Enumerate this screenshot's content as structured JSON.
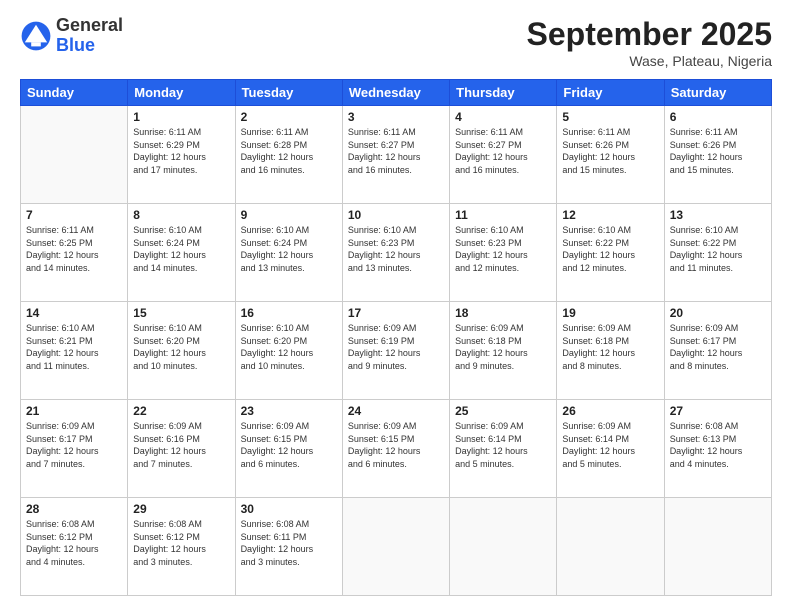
{
  "header": {
    "logo": {
      "general": "General",
      "blue": "Blue"
    },
    "title": "September 2025",
    "subtitle": "Wase, Plateau, Nigeria"
  },
  "calendar": {
    "days": [
      "Sunday",
      "Monday",
      "Tuesday",
      "Wednesday",
      "Thursday",
      "Friday",
      "Saturday"
    ],
    "weeks": [
      [
        {
          "day": "",
          "info": ""
        },
        {
          "day": "1",
          "info": "Sunrise: 6:11 AM\nSunset: 6:29 PM\nDaylight: 12 hours\nand 17 minutes."
        },
        {
          "day": "2",
          "info": "Sunrise: 6:11 AM\nSunset: 6:28 PM\nDaylight: 12 hours\nand 16 minutes."
        },
        {
          "day": "3",
          "info": "Sunrise: 6:11 AM\nSunset: 6:27 PM\nDaylight: 12 hours\nand 16 minutes."
        },
        {
          "day": "4",
          "info": "Sunrise: 6:11 AM\nSunset: 6:27 PM\nDaylight: 12 hours\nand 16 minutes."
        },
        {
          "day": "5",
          "info": "Sunrise: 6:11 AM\nSunset: 6:26 PM\nDaylight: 12 hours\nand 15 minutes."
        },
        {
          "day": "6",
          "info": "Sunrise: 6:11 AM\nSunset: 6:26 PM\nDaylight: 12 hours\nand 15 minutes."
        }
      ],
      [
        {
          "day": "7",
          "info": "Sunrise: 6:11 AM\nSunset: 6:25 PM\nDaylight: 12 hours\nand 14 minutes."
        },
        {
          "day": "8",
          "info": "Sunrise: 6:10 AM\nSunset: 6:24 PM\nDaylight: 12 hours\nand 14 minutes."
        },
        {
          "day": "9",
          "info": "Sunrise: 6:10 AM\nSunset: 6:24 PM\nDaylight: 12 hours\nand 13 minutes."
        },
        {
          "day": "10",
          "info": "Sunrise: 6:10 AM\nSunset: 6:23 PM\nDaylight: 12 hours\nand 13 minutes."
        },
        {
          "day": "11",
          "info": "Sunrise: 6:10 AM\nSunset: 6:23 PM\nDaylight: 12 hours\nand 12 minutes."
        },
        {
          "day": "12",
          "info": "Sunrise: 6:10 AM\nSunset: 6:22 PM\nDaylight: 12 hours\nand 12 minutes."
        },
        {
          "day": "13",
          "info": "Sunrise: 6:10 AM\nSunset: 6:22 PM\nDaylight: 12 hours\nand 11 minutes."
        }
      ],
      [
        {
          "day": "14",
          "info": "Sunrise: 6:10 AM\nSunset: 6:21 PM\nDaylight: 12 hours\nand 11 minutes."
        },
        {
          "day": "15",
          "info": "Sunrise: 6:10 AM\nSunset: 6:20 PM\nDaylight: 12 hours\nand 10 minutes."
        },
        {
          "day": "16",
          "info": "Sunrise: 6:10 AM\nSunset: 6:20 PM\nDaylight: 12 hours\nand 10 minutes."
        },
        {
          "day": "17",
          "info": "Sunrise: 6:09 AM\nSunset: 6:19 PM\nDaylight: 12 hours\nand 9 minutes."
        },
        {
          "day": "18",
          "info": "Sunrise: 6:09 AM\nSunset: 6:18 PM\nDaylight: 12 hours\nand 9 minutes."
        },
        {
          "day": "19",
          "info": "Sunrise: 6:09 AM\nSunset: 6:18 PM\nDaylight: 12 hours\nand 8 minutes."
        },
        {
          "day": "20",
          "info": "Sunrise: 6:09 AM\nSunset: 6:17 PM\nDaylight: 12 hours\nand 8 minutes."
        }
      ],
      [
        {
          "day": "21",
          "info": "Sunrise: 6:09 AM\nSunset: 6:17 PM\nDaylight: 12 hours\nand 7 minutes."
        },
        {
          "day": "22",
          "info": "Sunrise: 6:09 AM\nSunset: 6:16 PM\nDaylight: 12 hours\nand 7 minutes."
        },
        {
          "day": "23",
          "info": "Sunrise: 6:09 AM\nSunset: 6:15 PM\nDaylight: 12 hours\nand 6 minutes."
        },
        {
          "day": "24",
          "info": "Sunrise: 6:09 AM\nSunset: 6:15 PM\nDaylight: 12 hours\nand 6 minutes."
        },
        {
          "day": "25",
          "info": "Sunrise: 6:09 AM\nSunset: 6:14 PM\nDaylight: 12 hours\nand 5 minutes."
        },
        {
          "day": "26",
          "info": "Sunrise: 6:09 AM\nSunset: 6:14 PM\nDaylight: 12 hours\nand 5 minutes."
        },
        {
          "day": "27",
          "info": "Sunrise: 6:08 AM\nSunset: 6:13 PM\nDaylight: 12 hours\nand 4 minutes."
        }
      ],
      [
        {
          "day": "28",
          "info": "Sunrise: 6:08 AM\nSunset: 6:12 PM\nDaylight: 12 hours\nand 4 minutes."
        },
        {
          "day": "29",
          "info": "Sunrise: 6:08 AM\nSunset: 6:12 PM\nDaylight: 12 hours\nand 3 minutes."
        },
        {
          "day": "30",
          "info": "Sunrise: 6:08 AM\nSunset: 6:11 PM\nDaylight: 12 hours\nand 3 minutes."
        },
        {
          "day": "",
          "info": ""
        },
        {
          "day": "",
          "info": ""
        },
        {
          "day": "",
          "info": ""
        },
        {
          "day": "",
          "info": ""
        }
      ]
    ]
  }
}
